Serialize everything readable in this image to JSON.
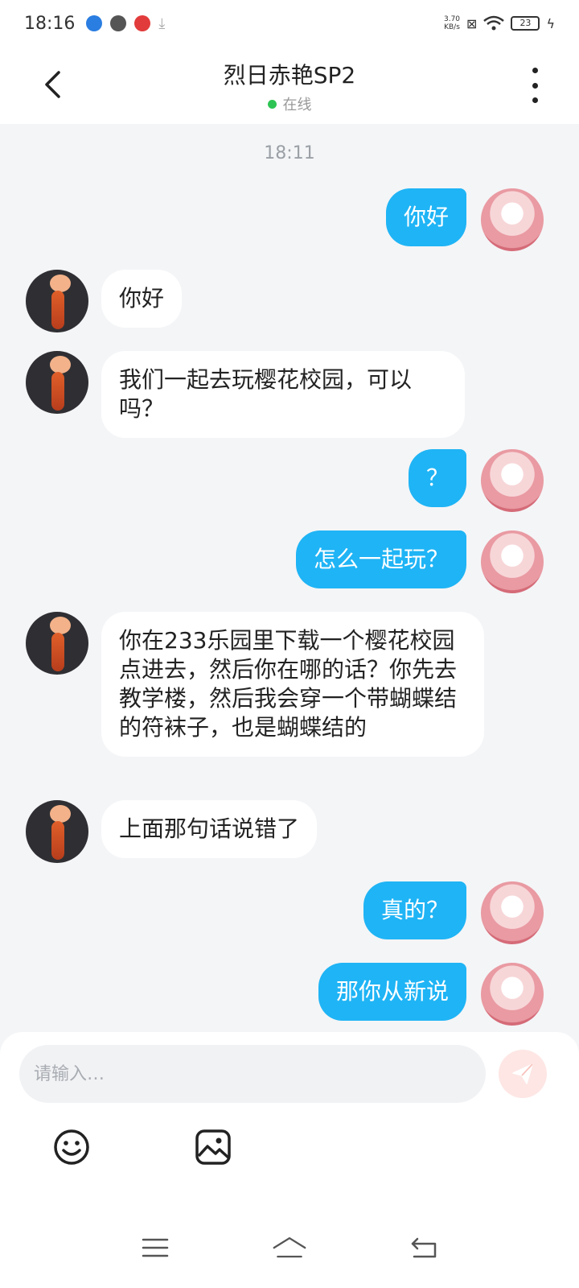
{
  "status_bar": {
    "time": "18:16",
    "net_speed_value": "3.70",
    "net_speed_unit": "KB/s",
    "battery": "23"
  },
  "header": {
    "title": "烈日赤艳SP2",
    "status": "在线"
  },
  "chat": {
    "timestamp": "18:11",
    "messages": [
      {
        "side": "right",
        "text": "你好"
      },
      {
        "side": "left",
        "text": "你好"
      },
      {
        "side": "left",
        "text": "我们一起去玩樱花校园，可以吗？"
      },
      {
        "side": "right",
        "text": "？"
      },
      {
        "side": "right",
        "text": "怎么一起玩？"
      },
      {
        "side": "left",
        "text": "你在233乐园里下载一个樱花校园点进去，然后你在哪的话？你先去教学楼，然后我会穿一个带蝴蝶结的符袜子，也是蝴蝶结的"
      },
      {
        "side": "left",
        "text": "上面那句话说错了"
      },
      {
        "side": "right",
        "text": "真的？"
      },
      {
        "side": "right",
        "text": "那你从新说"
      }
    ]
  },
  "composer": {
    "placeholder": "请输入…"
  },
  "colors": {
    "accent": "#1fb4f5",
    "send_button": "#fde6e4",
    "online_dot": "#2ec453"
  },
  "icons": {
    "back": "chevron-left-icon",
    "more": "more-vertical-icon",
    "send": "send-icon",
    "emoji": "emoji-icon",
    "image": "image-icon",
    "nav_menu": "menu-icon",
    "nav_home": "home-icon",
    "nav_back": "back-arrow-icon"
  }
}
